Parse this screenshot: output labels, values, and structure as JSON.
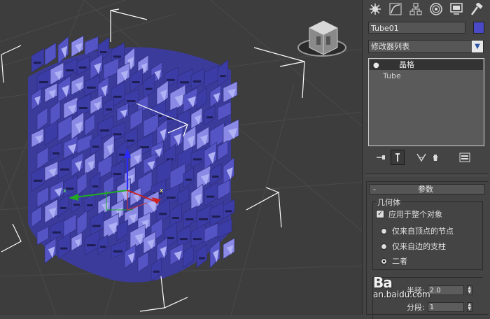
{
  "command_panel": {
    "tabs": [
      {
        "name": "create-tab",
        "icon": "star-burst-icon"
      },
      {
        "name": "modify-tab",
        "icon": "curve-icon"
      },
      {
        "name": "hierarchy-tab",
        "icon": "hierarchy-icon"
      },
      {
        "name": "motion-tab",
        "icon": "motion-icon"
      },
      {
        "name": "display-tab",
        "icon": "monitor-icon"
      },
      {
        "name": "utilities-tab",
        "icon": "hammer-icon"
      }
    ],
    "object_name": "Tube01",
    "object_color": "#4a4ac8",
    "modifier_list_label": "修改器列表",
    "modifier_stack": {
      "active": "晶格",
      "base": "Tube"
    }
  },
  "parameters": {
    "rollout_minus": "-",
    "rollout_title": "参数",
    "geometry_group_title": "几何体",
    "apply_to_entire_object": "应用于整个对象",
    "apply_checked_mark": "✓",
    "radio_options": [
      {
        "label": "仅来自顶点的节点",
        "selected": false
      },
      {
        "label": "仅来自边的支柱",
        "selected": false
      },
      {
        "label": "二者",
        "selected": true
      }
    ],
    "radius_label": "半径:",
    "radius_value": "2.0",
    "segments_label": "分段:",
    "segments_value": "1"
  },
  "watermark": {
    "logo": "Ba",
    "url": "an.baidu.com"
  }
}
